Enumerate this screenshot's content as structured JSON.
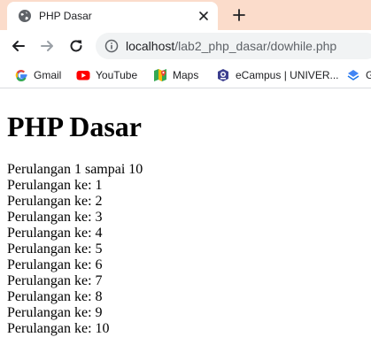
{
  "browser": {
    "tab": {
      "title": "PHP Dasar"
    },
    "address_bar": {
      "host": "localhost",
      "path": "/lab2_php_dasar/dowhile.php"
    },
    "bookmarks": [
      {
        "label": "Gmail",
        "icon": "google-icon"
      },
      {
        "label": "YouTube",
        "icon": "youtube-icon"
      },
      {
        "label": "Maps",
        "icon": "maps-icon"
      },
      {
        "label": "eCampus | UNIVER...",
        "icon": "ecampus-icon"
      },
      {
        "label": "G",
        "icon": "bookmark-icon"
      }
    ]
  },
  "page": {
    "heading": "PHP Dasar",
    "intro": "Perulangan 1 sampai 10",
    "lines": [
      "Perulangan ke: 1",
      "Perulangan ke: 2",
      "Perulangan ke: 3",
      "Perulangan ke: 4",
      "Perulangan ke: 5",
      "Perulangan ke: 6",
      "Perulangan ke: 7",
      "Perulangan ke: 8",
      "Perulangan ke: 9",
      "Perulangan ke: 10"
    ]
  }
}
